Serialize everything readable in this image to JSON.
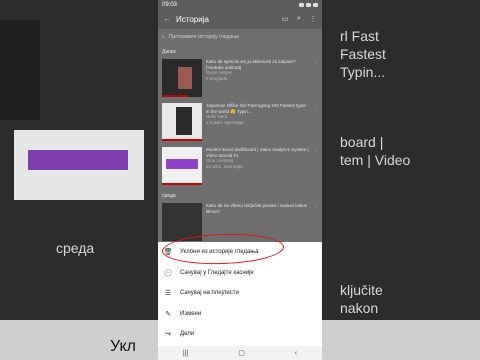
{
  "status": {
    "time": "09:03"
  },
  "appbar": {
    "title": "Историја"
  },
  "search": {
    "placeholder": "Претражите историју гледања"
  },
  "sections": [
    {
      "label": "Данас",
      "videos": [
        {
          "title": "Kako da spreciis sto ju aktivnosti za zatpute? [Youtube android]",
          "channel": "Sveta Helper",
          "meta": "8 pregleda"
        },
        {
          "title": "Japanese Office Girl Fast typing 440 Fastest typer in the world 😲 Typin...",
          "channel": "Hello Nerd",
          "meta": "2,3 мил. прегледа"
        },
        {
          "title": "Modern Excel dashboard | Sales Analytics System | Video tutorial #1",
          "channel": "Ston Lessons",
          "meta": "22 хиљ. прегледа"
        }
      ]
    },
    {
      "label": "среда",
      "videos": [
        {
          "title": "Kako da na Viberu isključite poruke i nastavi kakon likeas?",
          "channel": "",
          "meta": ""
        }
      ]
    }
  ],
  "sheet": {
    "items": [
      {
        "icon": "🗑",
        "label": "Уклони из историје гледања"
      },
      {
        "icon": "🕑",
        "label": "Сачувај у Гледајте касније"
      },
      {
        "icon": "☰",
        "label": "Сачувај на плејлисти"
      },
      {
        "icon": "✎",
        "label": "Измени"
      },
      {
        "icon": "↪",
        "label": "Дели"
      }
    ]
  },
  "background": {
    "left_text": "среда",
    "right_lines": [
      "rl Fast",
      "Fastest",
      "Typin...",
      "board |",
      "tem | Video",
      "ključite",
      "nakon"
    ],
    "bottom_left_text": "Укл"
  }
}
